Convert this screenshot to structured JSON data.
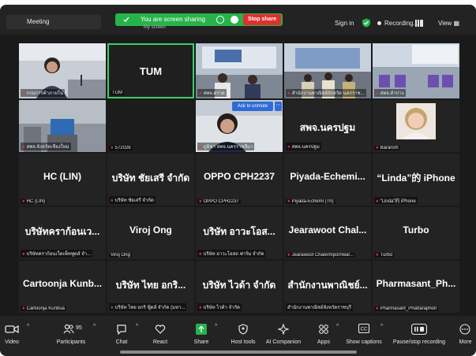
{
  "topbar": {
    "meeting_label": "Meeting",
    "share_text": "You are screen sharing",
    "stop_share": "Stop share",
    "my_screen": "My screen",
    "sign_in": "Sign in",
    "recording": "Recording...",
    "view": "View"
  },
  "colors": {
    "share_green": "#27b34a",
    "stop_red": "#e02f2f",
    "active_speaker": "#3bd06a",
    "muted_red": "#e53935"
  },
  "tiles": [
    {
      "name": "",
      "label": "กรมการค้าภายใน"
    },
    {
      "name": "TUM",
      "label": "TUM"
    },
    {
      "name": "",
      "label": "สพจ.ตราด"
    },
    {
      "name": "",
      "label": "สำนักงานพาณิชย์จังหวัด นครราช..."
    },
    {
      "name": "",
      "label": "สพจ.ลำปาง"
    },
    {
      "name": "",
      "label": "สพจ.จังหวัดเชียงใหม่"
    },
    {
      "name": "",
      "label": "572026"
    },
    {
      "name": "",
      "label": "ภูมิชา สพจ.นครราชสีมา",
      "overlay": "Ask to unmute"
    },
    {
      "name": "สพจ.นครปฐม",
      "label": "สพจ.นครปฐม"
    },
    {
      "name": "",
      "label": "Bararom"
    },
    {
      "name": "HC (LIN)",
      "label": "HC (LIN)"
    },
    {
      "name": "บริษัท ชัยเสรี จำกัด",
      "label": "บริษัท ชัยเสรี จำกัด"
    },
    {
      "name": "OPPO CPH2237",
      "label": "OPPO CPH2237"
    },
    {
      "name": "Piyada-Echemi...",
      "label": "Piyada-Echemi (Th)"
    },
    {
      "name": "“Linda”的 iPhone",
      "label": "“Linda”的 iPhone"
    },
    {
      "name": "บริษัทคราก้อนเว...",
      "label": "บริษัทคราก้อนเว็ตเพ็ทฟูดส์ จำ..."
    },
    {
      "name": "Viroj Ong",
      "label": "Viroj Ong"
    },
    {
      "name": "บริษัท อาวะโอส...",
      "label": "บริษัท อาวะโอสถ ฟาร์ม จำกัด"
    },
    {
      "name": "Jearawoot Chal...",
      "label": "Jearawoot Chalermpornwar..."
    },
    {
      "name": "Turbo",
      "label": "Turbo"
    },
    {
      "name": "Cartoonja Kunb...",
      "label": "Cartoonja Kunbua"
    },
    {
      "name": "บริษัท ไทย อกริ...",
      "label": "บริษัท ไทย อกริ ฟู้ดส์ จำกัด (มหา..."
    },
    {
      "name": "บริษัท ไวด้า จำกัด",
      "label": "บริษัท ไวด้า จำกัด"
    },
    {
      "name": "สำนักงานพาณิชย์...",
      "label": "สำนักงานพาณิชย์จังหวัดราชบุรี"
    },
    {
      "name": "Pharmasant_Ph...",
      "label": "Pharmasant_Phattaraphon"
    }
  ],
  "toolbar": {
    "video": "Video",
    "participants": "Participants",
    "participants_count": "95",
    "chat": "Chat",
    "react": "React",
    "share": "Share",
    "host_tools": "Host tools",
    "ai_companion": "AI Companion",
    "apps": "Apps",
    "show_captions": "Show captions",
    "pause_stop_recording": "Pause/stop recording",
    "more": "More"
  }
}
